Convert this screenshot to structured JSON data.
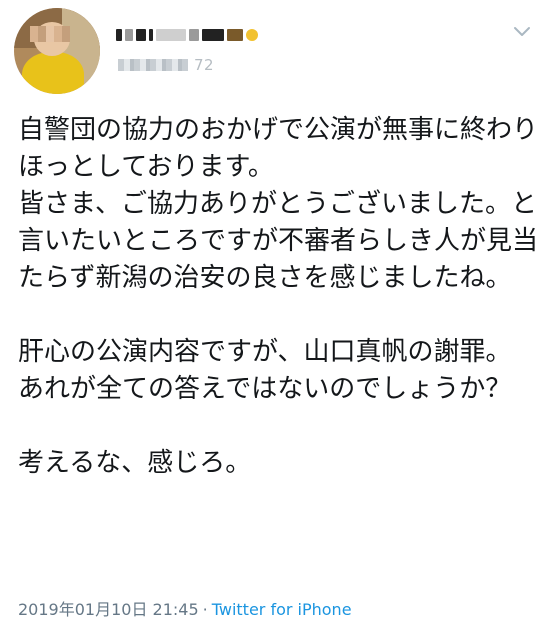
{
  "author": {
    "display_name": "",
    "handle_suffix": "72",
    "handle_prefix": "p"
  },
  "tweet": {
    "text": "自警団の協力のおかげで公演が無事に終わりほっとしております。\n皆さま、ご協力ありがとうございました。と言いたいところですが不審者らしき人が見当たらず新潟の治安の良さを感じましたね。\n\n肝心の公演内容ですが、山口真帆の謝罪。\nあれが全ての答えではないのでしょうか？\n\n考えるな、感じろ。",
    "timestamp": "2019年01月10日 21:45",
    "separator": "·",
    "source": "Twitter for iPhone"
  },
  "colors": {
    "text": "#14171a",
    "meta": "#657786",
    "link": "#1b95e0",
    "chevron": "#aab8c2"
  },
  "icons": {
    "menu": "chevron-down-icon"
  }
}
